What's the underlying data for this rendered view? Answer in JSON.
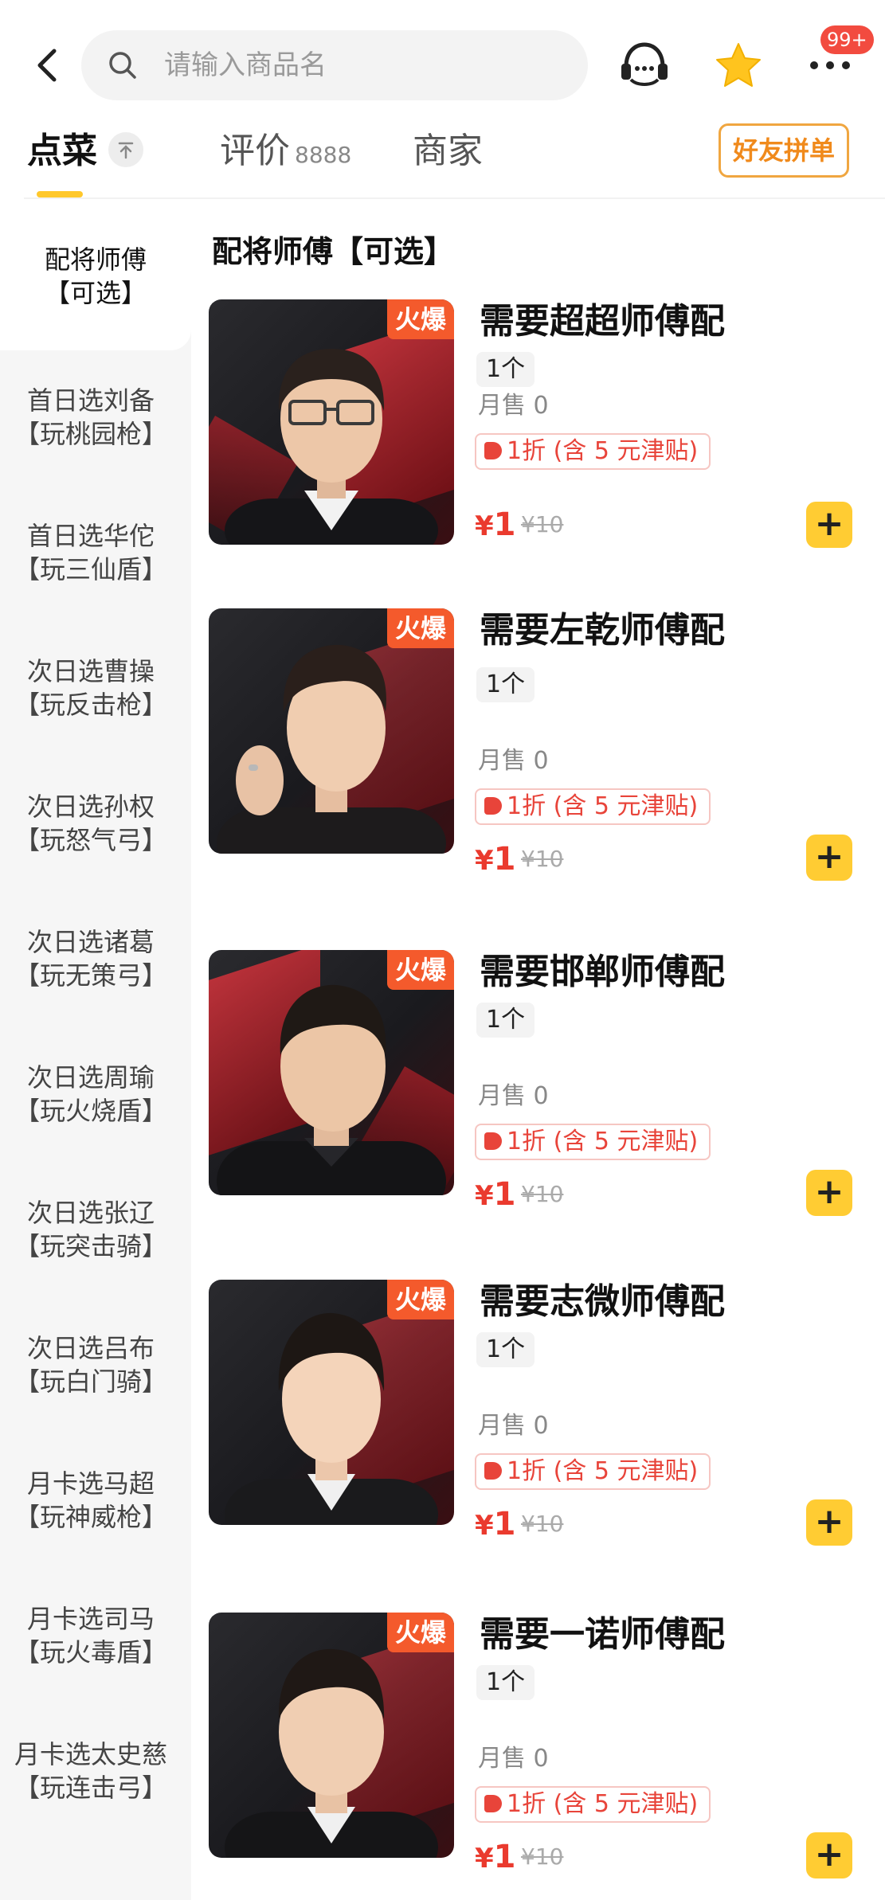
{
  "header": {
    "search_placeholder": "请输入商品名",
    "badge": "99+"
  },
  "tabs": {
    "order": "点菜",
    "review": "评价",
    "review_count": "8888",
    "merchant": "商家",
    "group_button": "好友拼单"
  },
  "sidebar": {
    "items": [
      {
        "line1": "配将师傅",
        "line2": "【可选】"
      },
      {
        "line1": "首日选刘备",
        "line2": "【玩桃园枪】"
      },
      {
        "line1": "首日选华佗",
        "line2": "【玩三仙盾】"
      },
      {
        "line1": "次日选曹操",
        "line2": "【玩反击枪】"
      },
      {
        "line1": "次日选孙权",
        "line2": "【玩怒气弓】"
      },
      {
        "line1": "次日选诸葛",
        "line2": "【玩无策弓】"
      },
      {
        "line1": "次日选周瑜",
        "line2": "【玩火烧盾】"
      },
      {
        "line1": "次日选张辽",
        "line2": "【玩突击骑】"
      },
      {
        "line1": "次日选吕布",
        "line2": "【玩白门骑】"
      },
      {
        "line1": "月卡选马超",
        "line2": "【玩神威枪】"
      },
      {
        "line1": "月卡选司马",
        "line2": "【玩火毒盾】"
      },
      {
        "line1": "月卡选太史慈",
        "line2": "【玩连击弓】"
      }
    ]
  },
  "section_title": "配将师傅【可选】",
  "products": [
    {
      "tag": "火爆",
      "name": "需要超超师傅配",
      "unit": "1个",
      "sales": "月售 0",
      "discount": "1折 (含 5 元津贴)",
      "price": "1",
      "currency": "¥",
      "original_price": "¥10",
      "add": "+"
    },
    {
      "tag": "火爆",
      "name": "需要左乾师傅配",
      "unit": "1个",
      "sales": "月售 0",
      "discount": "1折 (含 5 元津贴)",
      "price": "1",
      "currency": "¥",
      "original_price": "¥10",
      "add": "+"
    },
    {
      "tag": "火爆",
      "name": "需要邯郸师傅配",
      "unit": "1个",
      "sales": "月售 0",
      "discount": "1折 (含 5 元津贴)",
      "price": "1",
      "currency": "¥",
      "original_price": "¥10",
      "add": "+"
    },
    {
      "tag": "火爆",
      "name": "需要志微师傅配",
      "unit": "1个",
      "sales": "月售 0",
      "discount": "1折 (含 5 元津贴)",
      "price": "1",
      "currency": "¥",
      "original_price": "¥10",
      "add": "+"
    },
    {
      "tag": "火爆",
      "name": "需要一诺师傅配",
      "unit": "1个",
      "sales": "月售 0",
      "discount": "1折 (含 5 元津贴)",
      "price": "1",
      "currency": "¥",
      "original_price": "¥10",
      "add": "+"
    }
  ],
  "colors": {
    "accent": "#ffc82c",
    "price": "#ea3a2e",
    "hot_tag": "#f45a2c",
    "group_button": "#f08a1c"
  },
  "icons": [
    "back-icon",
    "search-icon",
    "customer-service-icon",
    "star-icon",
    "more-icon",
    "collapse-icon",
    "coupon-tag-icon",
    "plus-icon"
  ]
}
